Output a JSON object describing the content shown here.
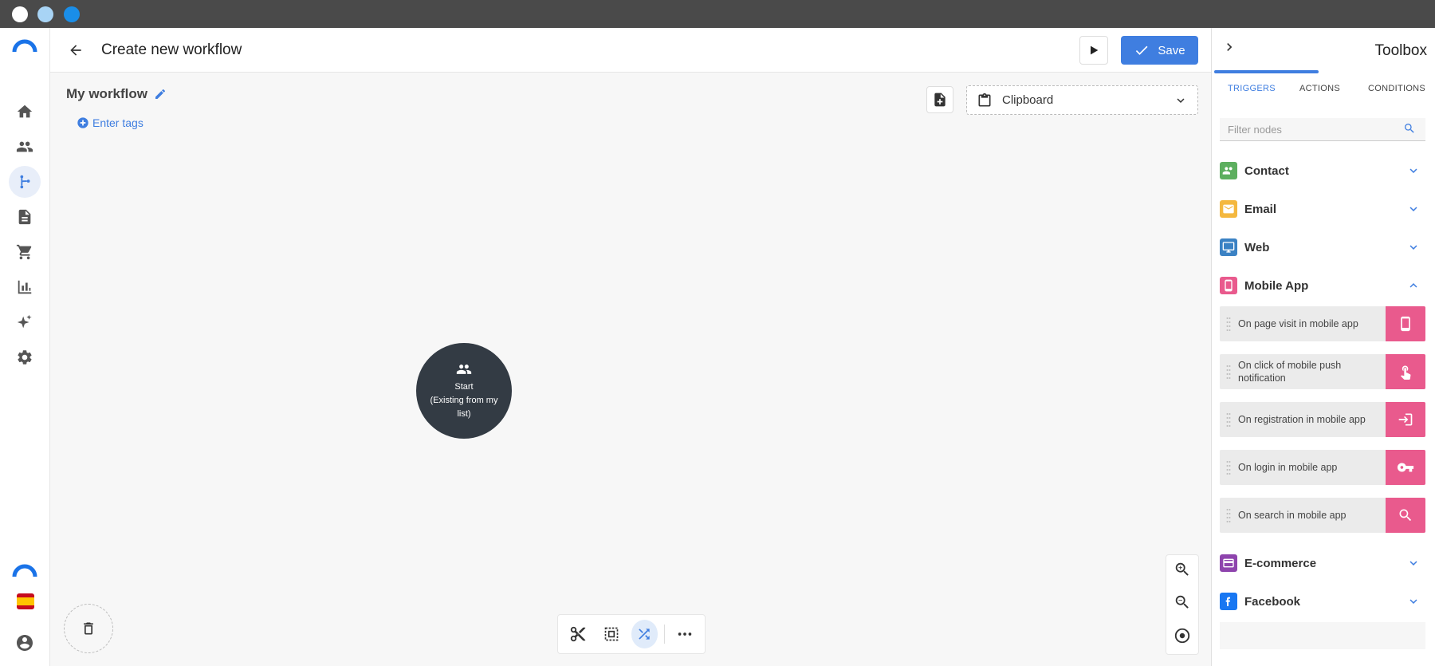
{
  "colors": {
    "accent": "#3f7ee0",
    "node_dark": "#333b44",
    "mobile_pink": "#e95a8d",
    "contact_green": "#5daf5f",
    "email_yellow": "#f4b83f",
    "web_blue": "#3b82c4",
    "ecommerce_purple": "#8e44ad",
    "facebook_blue": "#1877f2"
  },
  "window": {
    "dot_colors": [
      "#ffffff",
      "#a8d4f5",
      "#1a8ee8"
    ]
  },
  "nav": {
    "items": [
      {
        "icon": "home-icon"
      },
      {
        "icon": "users-icon"
      },
      {
        "icon": "workflow-icon",
        "active": true
      },
      {
        "icon": "document-icon"
      },
      {
        "icon": "cart-icon"
      },
      {
        "icon": "bar-chart-icon"
      },
      {
        "icon": "sparkle-icon"
      },
      {
        "icon": "gear-icon"
      }
    ]
  },
  "header": {
    "title": "Create new workflow",
    "save_label": "Save"
  },
  "canvas": {
    "workflow_name": "My workflow",
    "tags_label": "Enter tags",
    "clipboard_label": "Clipboard",
    "start_node": {
      "label": "Start",
      "sublabel": "(Existing from my list)"
    }
  },
  "toolbox": {
    "title": "Toolbox",
    "tabs": [
      "TRIGGERS",
      "ACTIONS",
      "CONDITIONS"
    ],
    "active_tab": "TRIGGERS",
    "filter_placeholder": "Filter nodes",
    "categories": {
      "contact": "Contact",
      "email": "Email",
      "web": "Web",
      "mobile_app": "Mobile App",
      "ecommerce": "E-commerce",
      "facebook": "Facebook"
    },
    "expanded_category": "Mobile App",
    "mobile_nodes": [
      "On page visit in mobile app",
      "On click of mobile push notification",
      "On registration in mobile app",
      "On login in mobile app",
      "On search in mobile app"
    ]
  }
}
